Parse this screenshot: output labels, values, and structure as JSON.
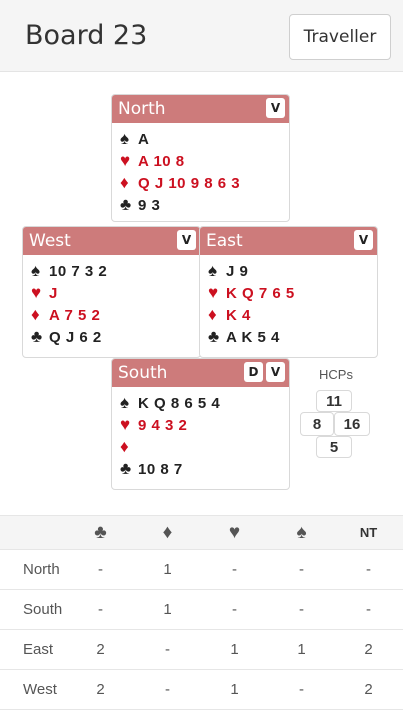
{
  "header": {
    "title": "Board 23",
    "traveller_label": "Traveller"
  },
  "hands": {
    "north": {
      "label": "North",
      "badges": [
        "V"
      ],
      "spades": "A",
      "hearts": "A 10 8",
      "diamonds": "Q J 10 9 8 6 3",
      "clubs": "9 3"
    },
    "west": {
      "label": "West",
      "badges": [
        "V"
      ],
      "spades": "10 7 3 2",
      "hearts": "J",
      "diamonds": "A 7 5 2",
      "clubs": "Q J 6 2"
    },
    "east": {
      "label": "East",
      "badges": [
        "V"
      ],
      "spades": "J 9",
      "hearts": "K Q 7 6 5",
      "diamonds": "K 4",
      "clubs": "A K 5 4"
    },
    "south": {
      "label": "South",
      "badges": [
        "D",
        "V"
      ],
      "spades": "K Q 8 6 5 4",
      "hearts": "9 4 3 2",
      "diamonds": "",
      "clubs": "10 8 7"
    }
  },
  "suits": {
    "spade": "♠",
    "heart": "♥",
    "diamond": "♦",
    "club": "♣"
  },
  "hcp": {
    "label": "HCPs",
    "north": "11",
    "west": "8",
    "east": "16",
    "south": "5"
  },
  "results": {
    "columns": [
      "♣",
      "♦",
      "♥",
      "♠",
      "NT"
    ],
    "rows": [
      {
        "name": "North",
        "values": [
          "-",
          "1",
          "-",
          "-",
          "-"
        ]
      },
      {
        "name": "South",
        "values": [
          "-",
          "1",
          "-",
          "-",
          "-"
        ]
      },
      {
        "name": "East",
        "values": [
          "2",
          "-",
          "1",
          "1",
          "2"
        ]
      },
      {
        "name": "West",
        "values": [
          "2",
          "-",
          "1",
          "-",
          "2"
        ]
      }
    ]
  },
  "colors": {
    "header_bg": "#cd7b7b",
    "red_suit": "#cc1020",
    "black_suit": "#222222"
  }
}
